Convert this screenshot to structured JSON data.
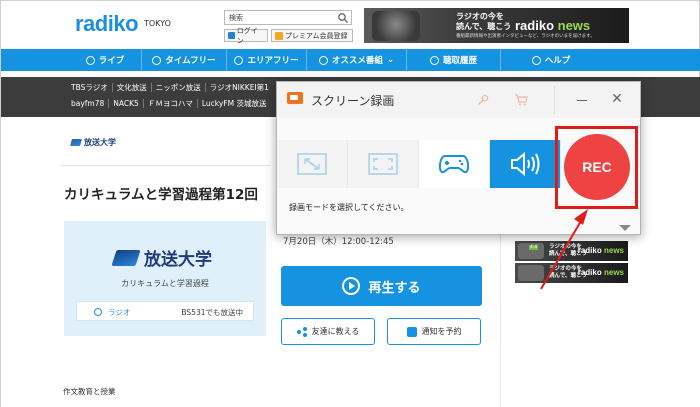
{
  "header": {
    "logo": "radiko",
    "area": "TOKYO",
    "search_placeholder": "検索",
    "login_label": "ログイン",
    "premium_label": "プレミアム会員登録",
    "banner": {
      "line1": "ラジオの今を",
      "line2": "読んで、聴こう",
      "sub": "番組最新情報や出演者インタビューなど、ラジオのいまを届けます。",
      "brand": "radiko",
      "brand_news": "news"
    }
  },
  "nav": {
    "items": [
      {
        "label": "ライブ",
        "icon": "wifi-icon"
      },
      {
        "label": "タイムフリー",
        "icon": "clock-check-icon"
      },
      {
        "label": "エリアフリー",
        "icon": "map-icon"
      },
      {
        "label": "オススメ番組",
        "icon": "star-icon"
      },
      {
        "label": "聴取履歴",
        "icon": "history-icon"
      },
      {
        "label": "ヘルプ",
        "icon": "help-icon"
      }
    ]
  },
  "stations": {
    "row1": [
      "TBSラジオ",
      "文化放送",
      "ニッポン放送",
      "ラジオNIKKEI第1"
    ],
    "row2": [
      "bayfm78",
      "NACK5",
      "ＦＭヨコハマ",
      "LuckyFM 茨城放送"
    ]
  },
  "main": {
    "station_name": "放送大学",
    "program_title": "カリキュラムと学習過程第12回",
    "card": {
      "logo_text": "放送大学",
      "subtitle": "カリキュラムと学習過程",
      "radio_label": "ラジオ",
      "broadcast_note": "BS531でも放送中"
    },
    "time": "7月20日（木）12:00-12:45",
    "play_label": "再生する",
    "share_label": "友達に教える",
    "reserve_label": "通知を予約",
    "description_label": "作文教育と授業"
  },
  "side_banners": [
    {
      "line1": "ラジオの今を",
      "line2": "読んで、聴こう",
      "brand": "radiko",
      "brand_news": "news",
      "tag": "4.4"
    },
    {
      "line1": "ラジオの今を",
      "line2": "読んで、聴こう",
      "brand": "radiko",
      "brand_news": "news",
      "tag": ""
    }
  ],
  "recorder": {
    "title": "スクリーン録画",
    "modes": [
      "region-mode",
      "fullscreen-mode",
      "game-mode",
      "audio-mode"
    ],
    "active_mode": "audio-mode",
    "instruction": "録画モードを選択してください。",
    "rec_label": "REC"
  },
  "colors": {
    "brand_blue": "#1693e0",
    "rec_red": "#ef4343",
    "highlight_red": "#e21b1b",
    "station_bar": "#3c3c3c"
  }
}
